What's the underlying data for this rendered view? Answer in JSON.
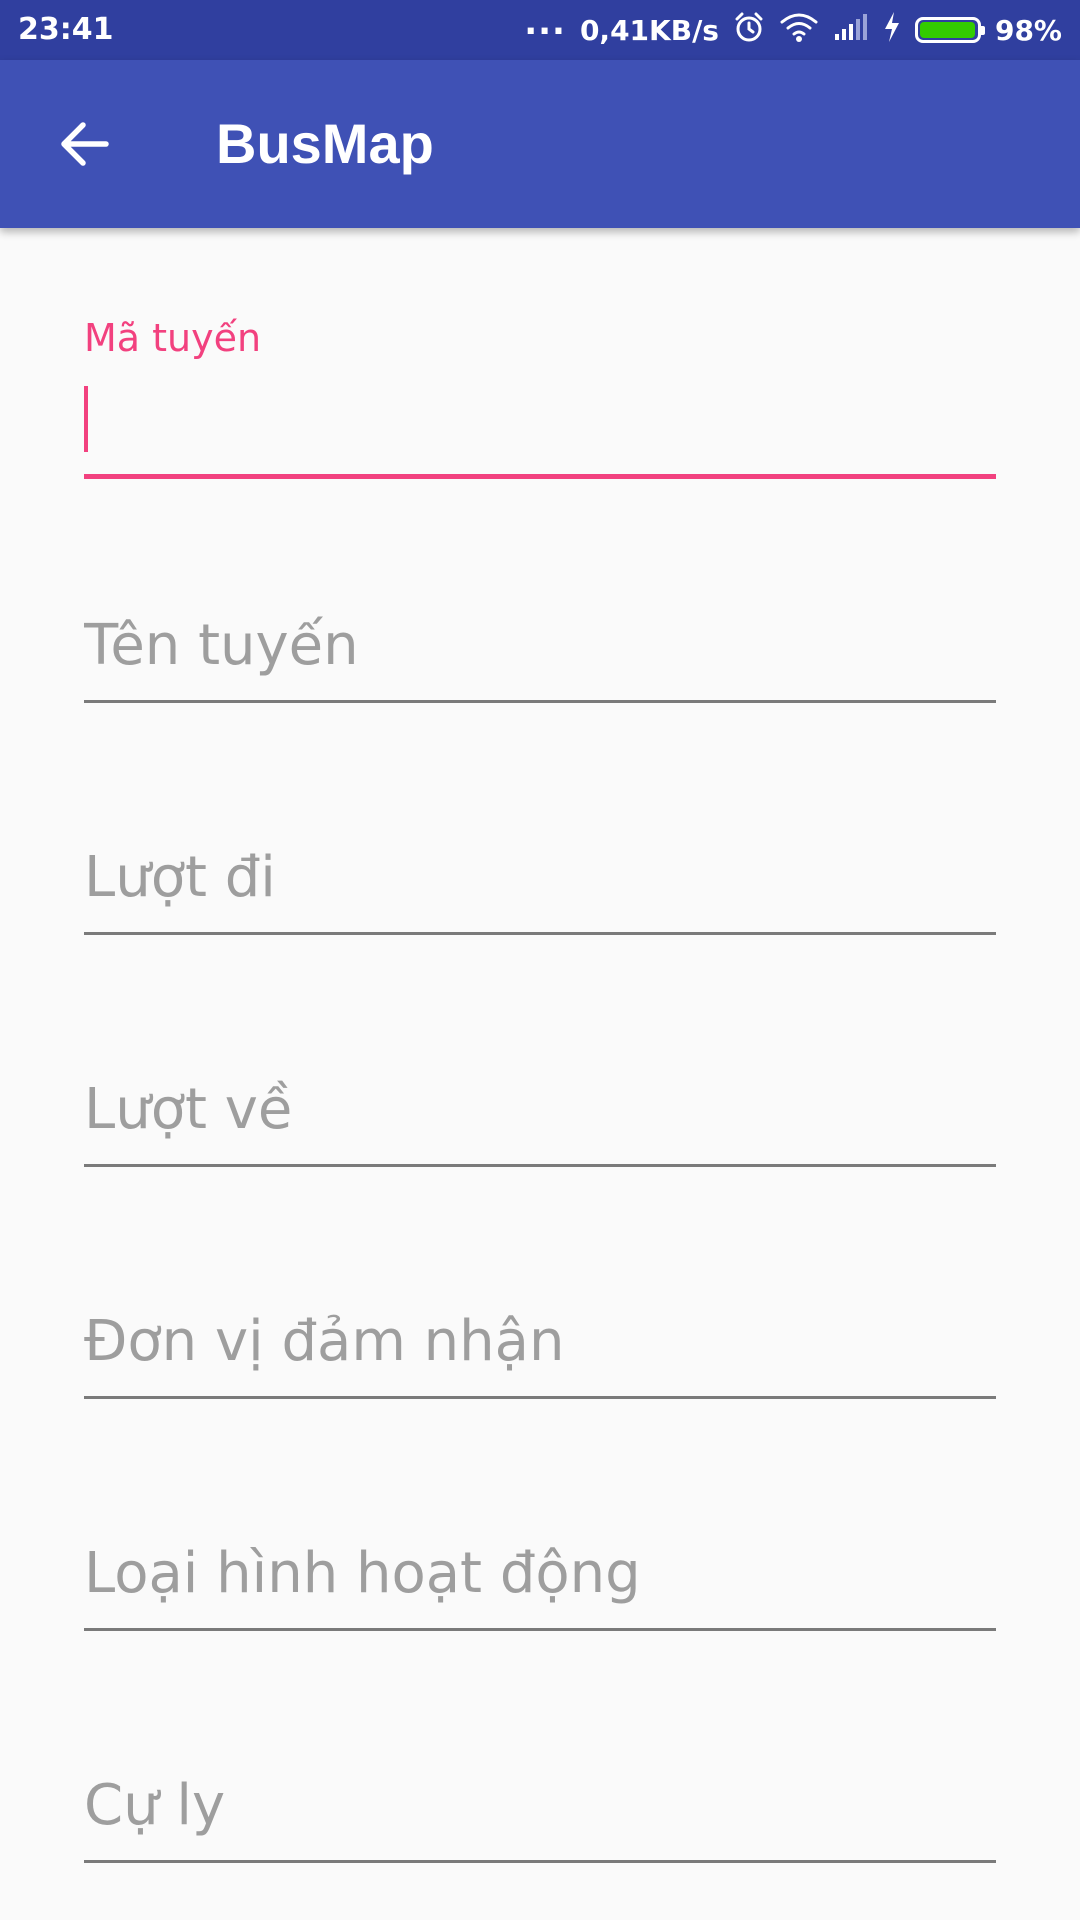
{
  "status_bar": {
    "time": "23:41",
    "dots": "...",
    "network_speed": "0,41KB/s",
    "battery_percent_text": "98%",
    "battery_level": 0.98,
    "icons": [
      "alarm-icon",
      "wifi-icon",
      "signal-icon",
      "charging-icon",
      "battery-icon"
    ]
  },
  "app_bar": {
    "title": "BusMap",
    "back_icon": "arrow-left-icon",
    "color": "#3f51b5"
  },
  "form": {
    "fields": [
      {
        "label": "Mã tuyến",
        "value": "",
        "focused": true
      },
      {
        "placeholder": "Tên tuyến",
        "value": ""
      },
      {
        "placeholder": "Lượt đi",
        "value": ""
      },
      {
        "placeholder": "Lượt về",
        "value": ""
      },
      {
        "placeholder": "Đơn vị đảm nhận",
        "value": ""
      },
      {
        "placeholder": "Loại hình hoạt động",
        "value": ""
      },
      {
        "placeholder": "Cự ly",
        "value": ""
      }
    ]
  },
  "colors": {
    "status_bar": "#303f9f",
    "accent": "#f2417f",
    "background": "#fafafa",
    "hint_text": "#9e9e9e"
  }
}
